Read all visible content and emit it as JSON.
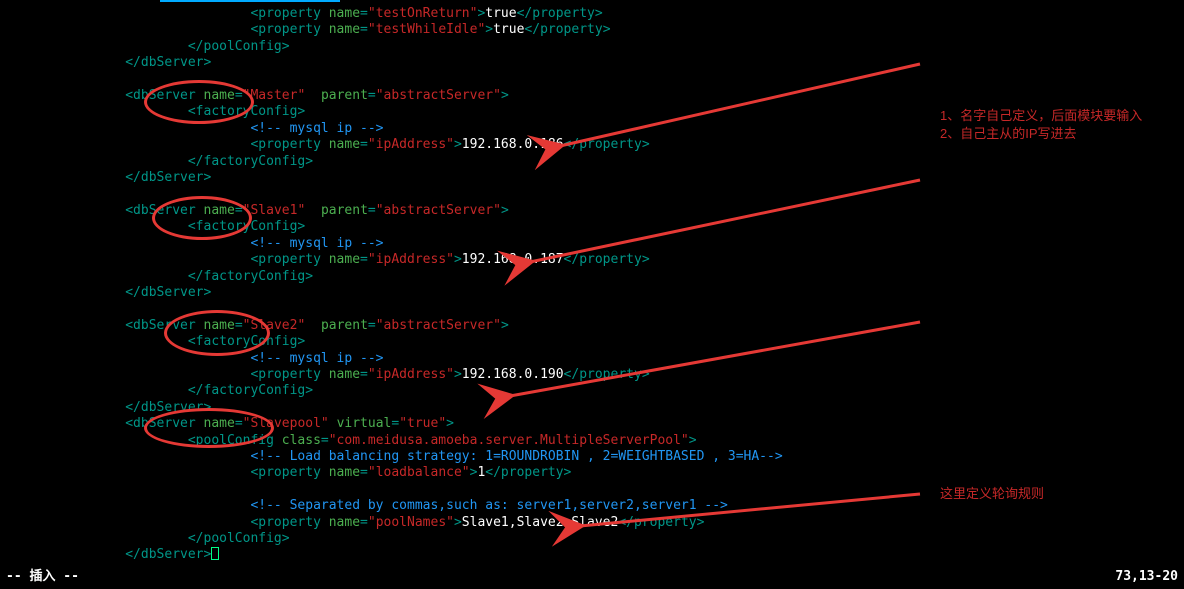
{
  "lines": [
    {
      "indent": 24,
      "seg": [
        {
          "c": "t-tag",
          "t": "<property "
        },
        {
          "c": "t-attr",
          "t": "name"
        },
        {
          "c": "t-tag",
          "t": "="
        },
        {
          "c": "t-str",
          "t": "\"testOnReturn\""
        },
        {
          "c": "t-tag",
          "t": ">"
        },
        {
          "c": "t-txt",
          "t": "true"
        },
        {
          "c": "t-tag",
          "t": "</property>"
        }
      ]
    },
    {
      "indent": 24,
      "seg": [
        {
          "c": "t-tag",
          "t": "<property "
        },
        {
          "c": "t-attr",
          "t": "name"
        },
        {
          "c": "t-tag",
          "t": "="
        },
        {
          "c": "t-str",
          "t": "\"testWhileIdle\""
        },
        {
          "c": "t-tag",
          "t": ">"
        },
        {
          "c": "t-txt",
          "t": "true"
        },
        {
          "c": "t-tag",
          "t": "</property>"
        }
      ]
    },
    {
      "indent": 16,
      "seg": [
        {
          "c": "t-tag",
          "t": "</poolConfig>"
        }
      ]
    },
    {
      "indent": 8,
      "seg": [
        {
          "c": "t-tag",
          "t": "</dbServer>"
        }
      ]
    },
    {
      "indent": 0,
      "seg": [
        {
          "c": "",
          "t": ""
        }
      ]
    },
    {
      "indent": 8,
      "seg": [
        {
          "c": "t-tag",
          "t": "<dbServer "
        },
        {
          "c": "t-attr",
          "t": "name"
        },
        {
          "c": "t-tag",
          "t": "="
        },
        {
          "c": "t-str",
          "t": "\"Master\""
        },
        {
          "c": "t-tag",
          "t": "  "
        },
        {
          "c": "t-attr",
          "t": "parent"
        },
        {
          "c": "t-tag",
          "t": "="
        },
        {
          "c": "t-str",
          "t": "\"abstractServer\""
        },
        {
          "c": "t-tag",
          "t": ">"
        }
      ]
    },
    {
      "indent": 16,
      "seg": [
        {
          "c": "t-tag",
          "t": "<factoryConfig>"
        }
      ]
    },
    {
      "indent": 24,
      "seg": [
        {
          "c": "t-cmt",
          "t": "<!-- mysql ip -->"
        }
      ]
    },
    {
      "indent": 24,
      "seg": [
        {
          "c": "t-tag",
          "t": "<property "
        },
        {
          "c": "t-attr",
          "t": "name"
        },
        {
          "c": "t-tag",
          "t": "="
        },
        {
          "c": "t-str",
          "t": "\"ipAddress\""
        },
        {
          "c": "t-tag",
          "t": ">"
        },
        {
          "c": "t-txt",
          "t": "192.168.0.186"
        },
        {
          "c": "t-tag",
          "t": "</property>"
        }
      ]
    },
    {
      "indent": 16,
      "seg": [
        {
          "c": "t-tag",
          "t": "</factoryConfig>"
        }
      ]
    },
    {
      "indent": 8,
      "seg": [
        {
          "c": "t-tag",
          "t": "</dbServer>"
        }
      ]
    },
    {
      "indent": 0,
      "seg": [
        {
          "c": "",
          "t": ""
        }
      ]
    },
    {
      "indent": 8,
      "seg": [
        {
          "c": "t-tag",
          "t": "<dbServer "
        },
        {
          "c": "t-attr",
          "t": "name"
        },
        {
          "c": "t-tag",
          "t": "="
        },
        {
          "c": "t-str",
          "t": "\"Slave1\""
        },
        {
          "c": "t-tag",
          "t": "  "
        },
        {
          "c": "t-attr",
          "t": "parent"
        },
        {
          "c": "t-tag",
          "t": "="
        },
        {
          "c": "t-str",
          "t": "\"abstractServer\""
        },
        {
          "c": "t-tag",
          "t": ">"
        }
      ]
    },
    {
      "indent": 16,
      "seg": [
        {
          "c": "t-tag",
          "t": "<factoryConfig>"
        }
      ]
    },
    {
      "indent": 24,
      "seg": [
        {
          "c": "t-cmt",
          "t": "<!-- mysql ip -->"
        }
      ]
    },
    {
      "indent": 24,
      "seg": [
        {
          "c": "t-tag",
          "t": "<property "
        },
        {
          "c": "t-attr",
          "t": "name"
        },
        {
          "c": "t-tag",
          "t": "="
        },
        {
          "c": "t-str",
          "t": "\"ipAddress\""
        },
        {
          "c": "t-tag",
          "t": ">"
        },
        {
          "c": "t-txt",
          "t": "192.168.0.187"
        },
        {
          "c": "t-tag",
          "t": "</property>"
        }
      ]
    },
    {
      "indent": 16,
      "seg": [
        {
          "c": "t-tag",
          "t": "</factoryConfig>"
        }
      ]
    },
    {
      "indent": 8,
      "seg": [
        {
          "c": "t-tag",
          "t": "</dbServer>"
        }
      ]
    },
    {
      "indent": 0,
      "seg": [
        {
          "c": "",
          "t": ""
        }
      ]
    },
    {
      "indent": 8,
      "seg": [
        {
          "c": "t-tag",
          "t": "<dbServer "
        },
        {
          "c": "t-attr",
          "t": "name"
        },
        {
          "c": "t-tag",
          "t": "="
        },
        {
          "c": "t-str",
          "t": "\"Slave2\""
        },
        {
          "c": "t-tag",
          "t": "  "
        },
        {
          "c": "t-attr",
          "t": "parent"
        },
        {
          "c": "t-tag",
          "t": "="
        },
        {
          "c": "t-str",
          "t": "\"abstractServer\""
        },
        {
          "c": "t-tag",
          "t": ">"
        }
      ]
    },
    {
      "indent": 16,
      "seg": [
        {
          "c": "t-tag",
          "t": "<factoryConfig>"
        }
      ]
    },
    {
      "indent": 24,
      "seg": [
        {
          "c": "t-cmt",
          "t": "<!-- mysql ip -->"
        }
      ]
    },
    {
      "indent": 24,
      "seg": [
        {
          "c": "t-tag",
          "t": "<property "
        },
        {
          "c": "t-attr",
          "t": "name"
        },
        {
          "c": "t-tag",
          "t": "="
        },
        {
          "c": "t-str",
          "t": "\"ipAddress\""
        },
        {
          "c": "t-tag",
          "t": ">"
        },
        {
          "c": "t-txt",
          "t": "192.168.0.190"
        },
        {
          "c": "t-tag",
          "t": "</property>"
        }
      ]
    },
    {
      "indent": 16,
      "seg": [
        {
          "c": "t-tag",
          "t": "</factoryConfig>"
        }
      ]
    },
    {
      "indent": 8,
      "seg": [
        {
          "c": "t-tag",
          "t": "</dbServer>"
        }
      ]
    },
    {
      "indent": 8,
      "seg": [
        {
          "c": "t-tag",
          "t": "<dbServer "
        },
        {
          "c": "t-attr",
          "t": "name"
        },
        {
          "c": "t-tag",
          "t": "="
        },
        {
          "c": "t-str",
          "t": "\"Slavepool\""
        },
        {
          "c": "t-tag",
          "t": " "
        },
        {
          "c": "t-attr",
          "t": "virtual"
        },
        {
          "c": "t-tag",
          "t": "="
        },
        {
          "c": "t-str",
          "t": "\"true\""
        },
        {
          "c": "t-tag",
          "t": ">"
        }
      ]
    },
    {
      "indent": 16,
      "seg": [
        {
          "c": "t-tag",
          "t": "<poolConfig "
        },
        {
          "c": "t-attr",
          "t": "class"
        },
        {
          "c": "t-tag",
          "t": "="
        },
        {
          "c": "t-str",
          "t": "\"com.meidusa.amoeba.server.MultipleServerPool\""
        },
        {
          "c": "t-tag",
          "t": ">"
        }
      ]
    },
    {
      "indent": 24,
      "seg": [
        {
          "c": "t-cmt",
          "t": "<!-- Load balancing strategy: 1=ROUNDROBIN , 2=WEIGHTBASED , 3=HA-->"
        }
      ]
    },
    {
      "indent": 24,
      "seg": [
        {
          "c": "t-tag",
          "t": "<property "
        },
        {
          "c": "t-attr",
          "t": "name"
        },
        {
          "c": "t-tag",
          "t": "="
        },
        {
          "c": "t-str",
          "t": "\"loadbalance\""
        },
        {
          "c": "t-tag",
          "t": ">"
        },
        {
          "c": "t-txt",
          "t": "1"
        },
        {
          "c": "t-tag",
          "t": "</property>"
        }
      ]
    },
    {
      "indent": 0,
      "seg": [
        {
          "c": "",
          "t": ""
        }
      ]
    },
    {
      "indent": 24,
      "seg": [
        {
          "c": "t-cmt",
          "t": "<!-- Separated by commas,such as: server1,server2,server1 -->"
        }
      ]
    },
    {
      "indent": 24,
      "seg": [
        {
          "c": "t-tag",
          "t": "<property "
        },
        {
          "c": "t-attr",
          "t": "name"
        },
        {
          "c": "t-tag",
          "t": "="
        },
        {
          "c": "t-str",
          "t": "\"poolNames\""
        },
        {
          "c": "t-tag",
          "t": ">"
        },
        {
          "c": "t-txt",
          "t": "Slave1,Slave2,Slave2"
        },
        {
          "c": "t-tag",
          "t": "</property>"
        }
      ]
    },
    {
      "indent": 16,
      "seg": [
        {
          "c": "t-tag",
          "t": "</poolConfig>"
        }
      ]
    },
    {
      "indent": 8,
      "seg": [
        {
          "c": "t-tag",
          "t": "</dbServer>"
        }
      ],
      "cursor": true
    }
  ],
  "notes": {
    "n1": "1、名字自己定义，后面模块要输入",
    "n2": "2、自己主从的IP写进去",
    "n3": "这里定义轮询规则"
  },
  "status": {
    "mode": "-- 插入 --",
    "pos": "73,13-20"
  }
}
